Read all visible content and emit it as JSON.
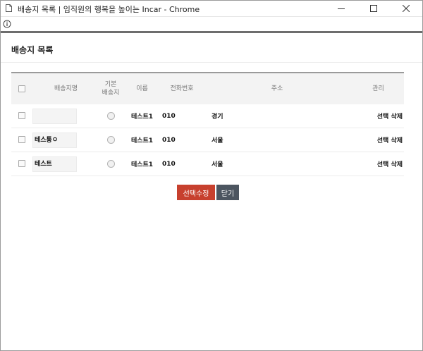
{
  "window": {
    "title": "배송지 목록 | 임직원의 행복을 높이는 Incar - Chrome"
  },
  "page": {
    "title": "배송지 목록"
  },
  "table": {
    "headers": {
      "select": "",
      "name": "배송지명",
      "default_line1": "기본",
      "default_line2": "배송지",
      "recipient": "이름",
      "phone": "전화번호",
      "address": "주소",
      "manage": "관리"
    },
    "rows": [
      {
        "name": "",
        "recipient": "테스트1",
        "phone": "010",
        "address": "경기",
        "select_label": "선택",
        "delete_label": "삭제"
      },
      {
        "name": "테스통ㅇ",
        "recipient": "테스트1",
        "phone": "010",
        "address": "서울",
        "select_label": "선택",
        "delete_label": "삭제"
      },
      {
        "name": "테스트",
        "recipient": "테스트1",
        "phone": "010",
        "address": "서울",
        "select_label": "선택",
        "delete_label": "삭제"
      }
    ]
  },
  "buttons": {
    "save_label": "선택수정",
    "close_label": "닫기"
  },
  "colors": {
    "save_button": "#c7402e",
    "close_button": "#4c5560",
    "header_border": "#9a9a9a"
  }
}
